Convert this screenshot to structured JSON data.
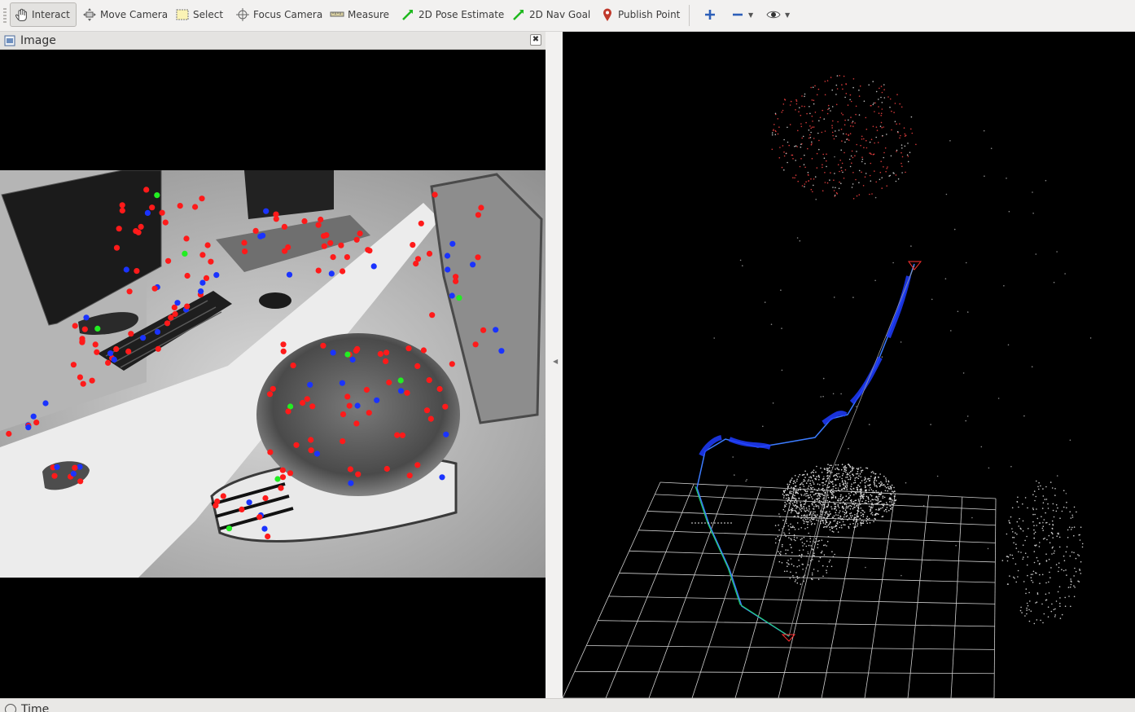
{
  "toolbar": {
    "items": [
      {
        "label": "Interact",
        "icon": "hand-cursor-icon",
        "active": true
      },
      {
        "label": "Move Camera",
        "icon": "move-camera-icon"
      },
      {
        "label": "Select",
        "icon": "select-box-icon"
      },
      {
        "label": "Focus Camera",
        "icon": "crosshair-icon"
      },
      {
        "label": "Measure",
        "icon": "ruler-icon"
      },
      {
        "label": "2D Pose Estimate",
        "icon": "green-arrow-icon"
      },
      {
        "label": "2D Nav Goal",
        "icon": "green-arrow-icon"
      },
      {
        "label": "Publish Point",
        "icon": "map-pin-icon"
      }
    ],
    "extra_icons": [
      "plus-icon",
      "minus-icon",
      "eye-icon"
    ]
  },
  "image_panel": {
    "title": "Image",
    "close_symbol": "✖"
  },
  "time_panel": {
    "title": "Time"
  },
  "colors": {
    "tracked_feature": "#ff1a1a",
    "new_feature": "#1a33ff",
    "matched_feature": "#22ee22",
    "trajectory": "#2244ff",
    "grid": "#cfcfcf",
    "point_cloud": "#dddddd"
  }
}
